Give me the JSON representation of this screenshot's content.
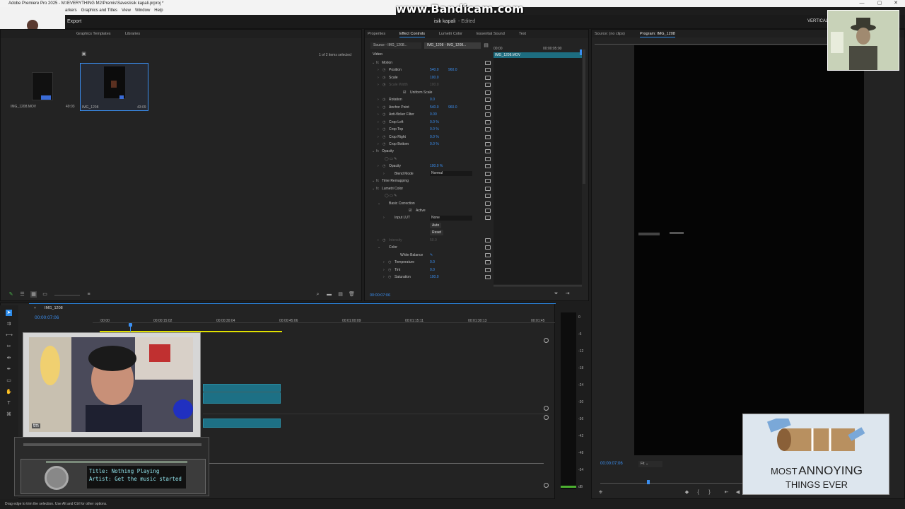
{
  "window": {
    "title": "Adobe Premiere Pro 2025 - M:\\EVERYTHING M2\\Premis\\Saves\\isik kapali.prproj *"
  },
  "menu": [
    "arkers",
    "Graphics and Titles",
    "View",
    "Window",
    "Help"
  ],
  "watermark": "www.Bandicam.com",
  "header": {
    "export": "Export",
    "project_name": "isik kapali",
    "status": "- Edited",
    "workspace": "VERTICAL"
  },
  "project_panel": {
    "tabs": [
      "Graphics Templates",
      "Libraries"
    ],
    "selection_info": "1 of 2 items selected",
    "items": [
      {
        "name": "IMG_1208.MOV",
        "duration": "49:03"
      },
      {
        "name": "IMG_1208",
        "duration": "43:09"
      }
    ]
  },
  "effect_controls": {
    "tabs": [
      "Properties",
      "Effect Controls",
      "Lumetri Color",
      "Essential Sound",
      "Text"
    ],
    "source_label": "Source - IMG_1208...",
    "clip_label": "IMG_1208 - IMG_1208...",
    "mini_time_start": "00:00",
    "mini_time_end": "00:00:05:00",
    "mini_clip": "IMG_1208.MOV",
    "timecode": "00:00:07:06",
    "section_video": "Video",
    "rows": [
      {
        "label": "Motion",
        "indent": 1,
        "fx": true
      },
      {
        "label": "Position",
        "indent": 2,
        "v1": "540.0",
        "v2": "960.0"
      },
      {
        "label": "Scale",
        "indent": 2,
        "v1": "100.0"
      },
      {
        "label": "Scale Width",
        "indent": 2,
        "v1": "100.0",
        "dim": true
      },
      {
        "label": "Uniform Scale",
        "indent": 3,
        "check": true
      },
      {
        "label": "Rotation",
        "indent": 2,
        "v1": "0.0"
      },
      {
        "label": "Anchor Point",
        "indent": 2,
        "v1": "540.0",
        "v2": "960.0"
      },
      {
        "label": "Anti-flicker Filter",
        "indent": 2,
        "v1": "0.00"
      },
      {
        "label": "Crop Left",
        "indent": 2,
        "v1": "0.0 %"
      },
      {
        "label": "Crop Top",
        "indent": 2,
        "v1": "0.0 %"
      },
      {
        "label": "Crop Right",
        "indent": 2,
        "v1": "0.0 %"
      },
      {
        "label": "Crop Bottom",
        "indent": 2,
        "v1": "0.0 %"
      },
      {
        "label": "Opacity",
        "indent": 1,
        "fx": true
      },
      {
        "label": "",
        "indent": 2,
        "masks": true
      },
      {
        "label": "Opacity",
        "indent": 2,
        "v1": "100.0 %"
      },
      {
        "label": "Blend Mode",
        "indent": 3,
        "dropdown": "Normal"
      },
      {
        "label": "Time Remapping",
        "indent": 1,
        "fx": true
      },
      {
        "label": "Lumetri Color",
        "indent": 1,
        "fx": true
      },
      {
        "label": "",
        "indent": 2,
        "masks": true
      },
      {
        "label": "Basic Correction",
        "indent": 2
      },
      {
        "label": "Active",
        "indent": 4,
        "check": true
      },
      {
        "label": "Input LUT",
        "indent": 3,
        "dropdown": "None"
      },
      {
        "label": "",
        "indent": 4,
        "button": "Auto"
      },
      {
        "label": "",
        "indent": 4,
        "button": "Reset"
      },
      {
        "label": "Intensity",
        "indent": 2,
        "v1": "50.0",
        "dim": true
      },
      {
        "label": "Color",
        "indent": 2
      },
      {
        "label": "White Balance",
        "indent": 4,
        "picker": true
      },
      {
        "label": "Temperature",
        "indent": 3,
        "v1": "0.0"
      },
      {
        "label": "Tint",
        "indent": 3,
        "v1": "0.0"
      },
      {
        "label": "Saturation",
        "indent": 3,
        "v1": "100.0"
      }
    ]
  },
  "program_monitor": {
    "tabs": [
      "Source: (no clips)",
      "Program: IMG_1208"
    ],
    "timecode": "00:00:07:06",
    "fit": "Fit"
  },
  "timeline": {
    "sequence": "IMG_1208",
    "timecode": "00:00:07:06",
    "ruler": [
      ":00:00",
      "00:00:15:02",
      "00:00:30:04",
      "00:00:45:06",
      "00:01:00:09",
      "00:01:15:11",
      "00:01:30:13",
      "00:01:45"
    ]
  },
  "meter_scale": [
    "0",
    "-6",
    "-12",
    "-18",
    "-24",
    "-30",
    "-36",
    "-42",
    "-48",
    "-54",
    "dB"
  ],
  "status_bar": "Drag edge to trim the selection. Use Alt and Ctrl for other options.",
  "music_widget": {
    "title": "Title: Nothing Playing",
    "artist": "Artist: Get the music started"
  },
  "meme_caption": {
    "line1": "MOST",
    "line2": "ANNOYING",
    "line3": "THINGS EVER"
  },
  "webcam_tag": "tm"
}
